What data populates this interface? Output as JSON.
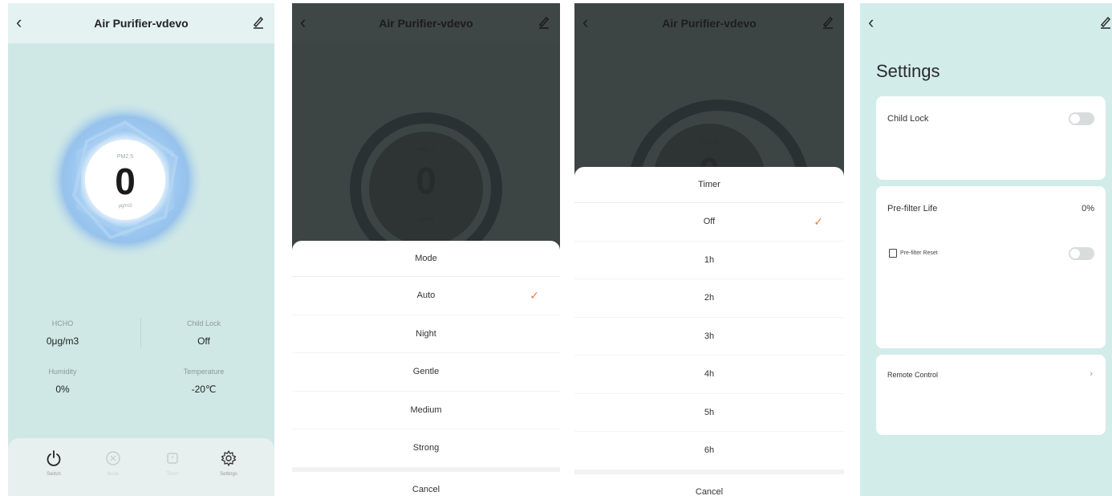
{
  "device_title": "Air Purifier-vdevo",
  "main": {
    "pm_label": "PM2.5",
    "pm_value": "0",
    "pm_unit": "μg/m3",
    "stats": [
      {
        "label": "HCHO",
        "value": "0μg/m3"
      },
      {
        "label": "Child Lock",
        "value": "Off"
      },
      {
        "label": "Humidity",
        "value": "0%"
      },
      {
        "label": "Temperature",
        "value": "-20℃"
      }
    ],
    "nav": [
      {
        "label": "Switch",
        "icon": "power-icon"
      },
      {
        "label": "Mode",
        "icon": "fan-mode-icon"
      },
      {
        "label": "Timer",
        "icon": "timer-icon"
      },
      {
        "label": "Settings",
        "icon": "gear-icon"
      }
    ]
  },
  "mode_sheet": {
    "title": "Mode",
    "options": [
      "Auto",
      "Night",
      "Gentle",
      "Medium",
      "Strong"
    ],
    "selected": "Auto",
    "cancel": "Cancel"
  },
  "timer_sheet": {
    "title": "Timer",
    "options": [
      "Off",
      "1h",
      "2h",
      "3h",
      "4h",
      "5h",
      "6h"
    ],
    "selected": "Off",
    "cancel": "Cancel"
  },
  "settings": {
    "title": "Settings",
    "child_lock_label": "Child Lock",
    "child_lock_on": false,
    "prefilter_label": "Pre-filter Life",
    "prefilter_value": "0%",
    "prefilter_reset_label": "Pre-filter Reset",
    "prefilter_reset_on": false,
    "remote_label": "Remote Control"
  },
  "colors": {
    "background": "#cfe8e6",
    "check": "#f07a4a",
    "ring": "#8fbff0"
  }
}
